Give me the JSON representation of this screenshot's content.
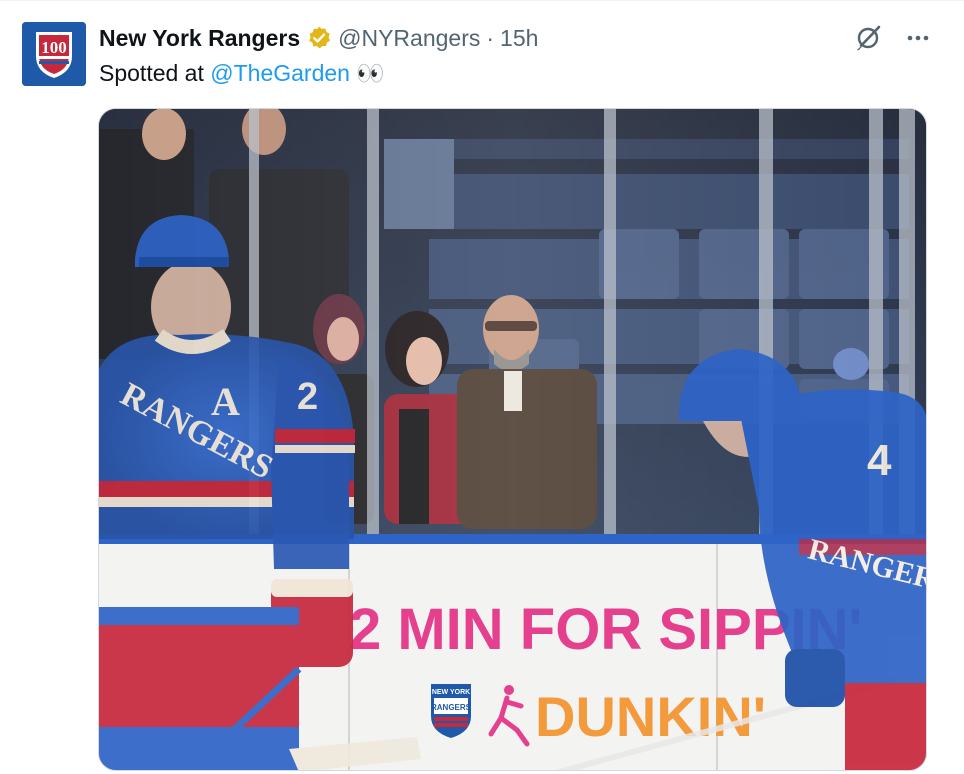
{
  "tweet": {
    "author": {
      "display_name": "New York Rangers",
      "handle": "@NYRangers",
      "verified": true,
      "avatar_text": "100",
      "avatar_color": "#1e5aa8"
    },
    "separator": "·",
    "time": "15h",
    "text_prefix": "Spotted at",
    "mention": "@TheGarden",
    "emoji": "👀",
    "icons": {
      "grok": "grok-icon",
      "more": "more-icon",
      "verified": "gold-verified-badge-icon"
    },
    "colors": {
      "link": "#1d9bf0",
      "muted": "#536471",
      "gold_badge": "#e2b719",
      "jersey_blue": "#2e63c7",
      "jersey_red": "#c8283c",
      "board_pink": "#e5408e",
      "board_orange": "#f29a3c"
    }
  },
  "media": {
    "board_line1": "2 MIN FOR SIPPIN'",
    "board_logo_text": "DUNKIN'",
    "rangers_logo_text_top": "NEW YORK",
    "rangers_logo_text_bottom": "RANGERS",
    "jersey_left_text": "RANGERS",
    "jersey_left_letter": "A",
    "jersey_left_number": "2",
    "jersey_right_number": "4",
    "jersey_right_text": "RANGERS"
  }
}
